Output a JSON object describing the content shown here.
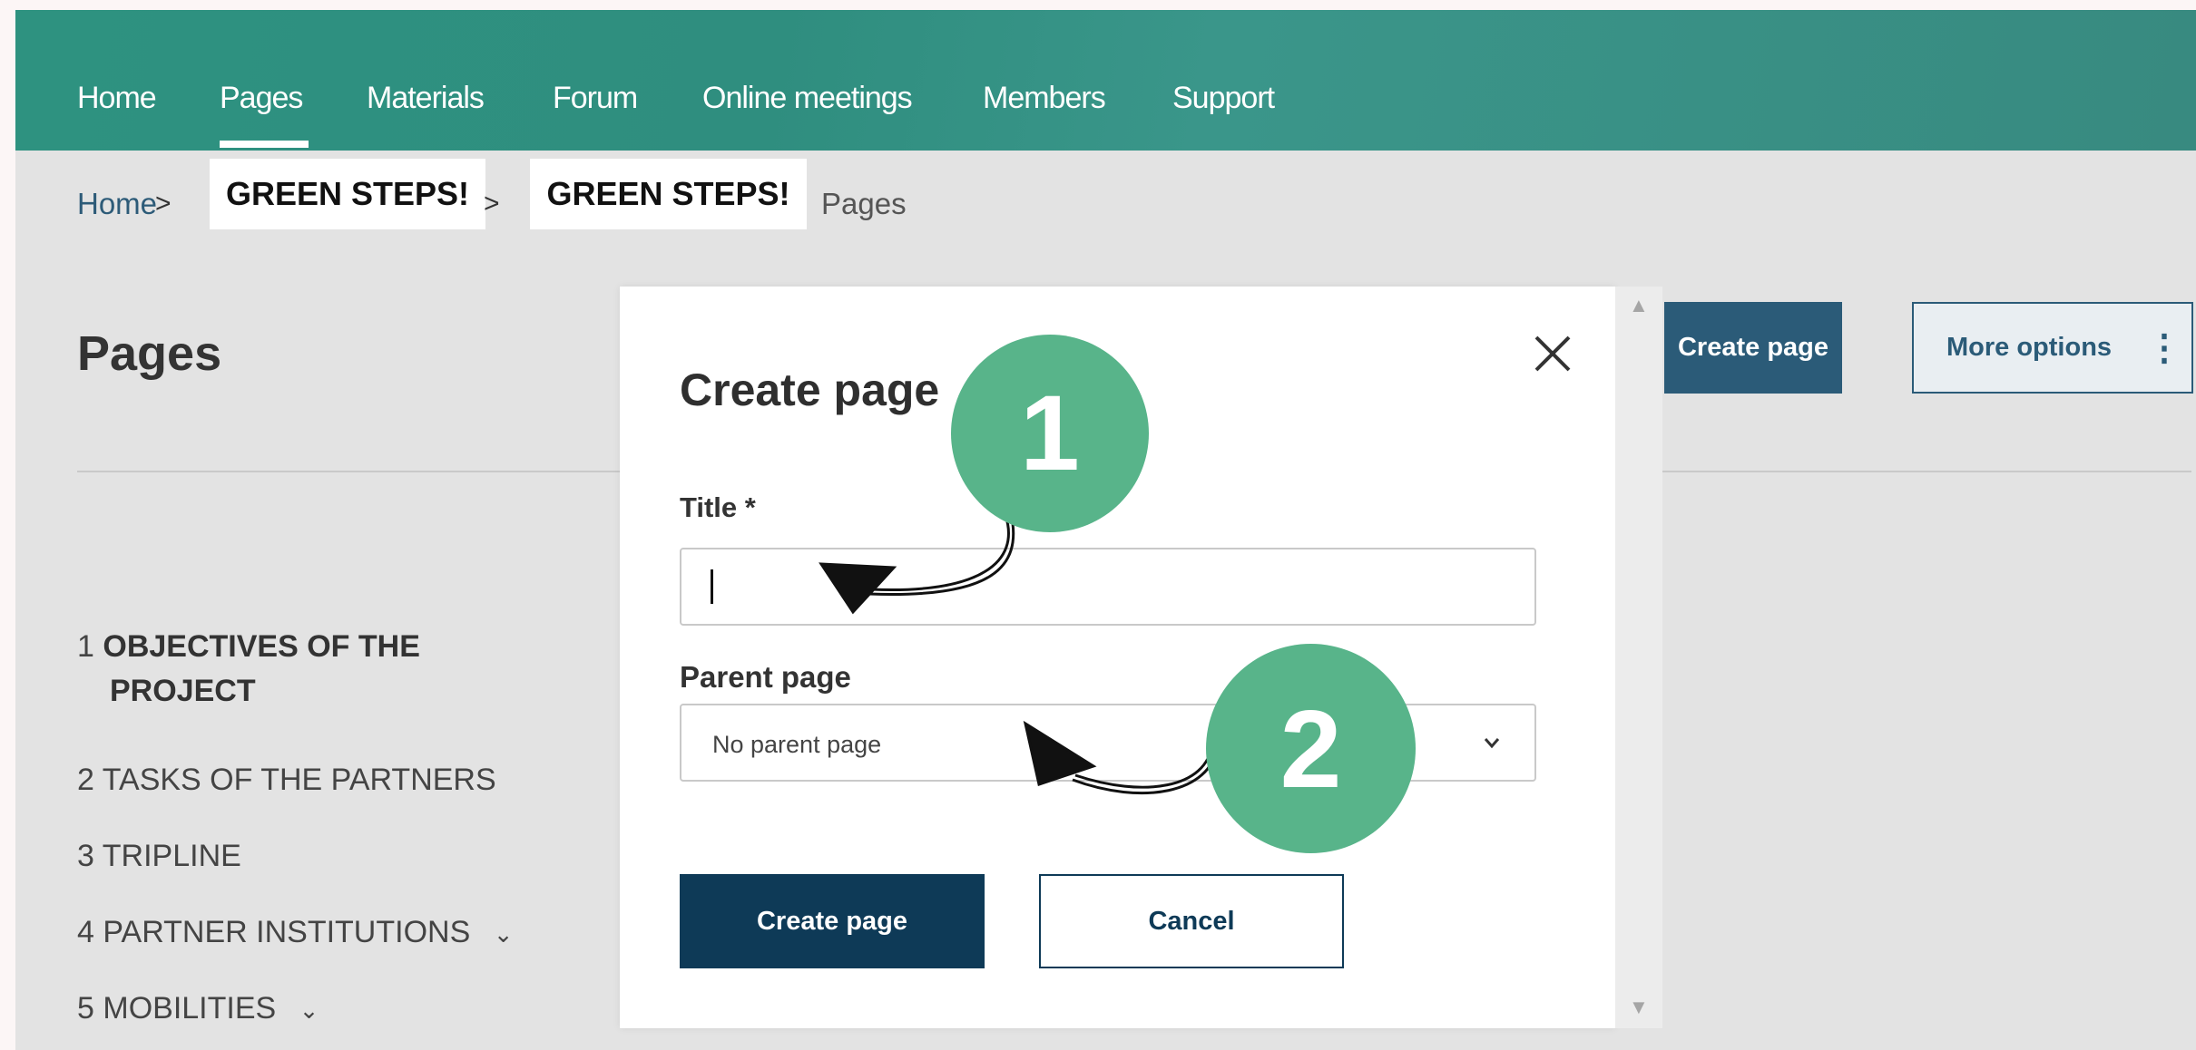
{
  "nav": {
    "items": [
      {
        "label": "Home"
      },
      {
        "label": "Pages"
      },
      {
        "label": "Materials"
      },
      {
        "label": "Forum"
      },
      {
        "label": "Online meetings"
      },
      {
        "label": "Members"
      },
      {
        "label": "Support"
      }
    ],
    "active": "Pages"
  },
  "breadcrumb": {
    "home": "Home",
    "group_a": "GREEN STEPS!",
    "group_b": "GREEN STEPS!",
    "current": "Pages",
    "separator": ">"
  },
  "page": {
    "title": "Pages",
    "create_button": "Create page",
    "more_options_button": "More options"
  },
  "toc": [
    {
      "number": "1",
      "label": "OBJECTIVES OF THE",
      "label_line2": "PROJECT"
    },
    {
      "number": "2",
      "label": "TASKS OF THE PARTNERS"
    },
    {
      "number": "3",
      "label": "TRIPLINE"
    },
    {
      "number": "4",
      "label": "PARTNER INSTITUTIONS",
      "expandable": true
    },
    {
      "number": "5",
      "label": "MOBILITIES",
      "expandable": true
    }
  ],
  "modal": {
    "title": "Create page",
    "title_label": "Title *",
    "title_value": "",
    "parent_label": "Parent page",
    "parent_value": "No parent page",
    "create_button": "Create page",
    "cancel_button": "Cancel"
  },
  "annotations": {
    "step1": "1",
    "step2": "2",
    "color": "#58b48a"
  },
  "colors": {
    "nav_bg": "#2f8e7f",
    "primary_button": "#0e3a57",
    "header_button": "#2b5b78"
  },
  "icons": [
    "close-icon",
    "chevron-down-icon",
    "kebab-icon",
    "scroll-up-icon",
    "scroll-down-icon"
  ]
}
